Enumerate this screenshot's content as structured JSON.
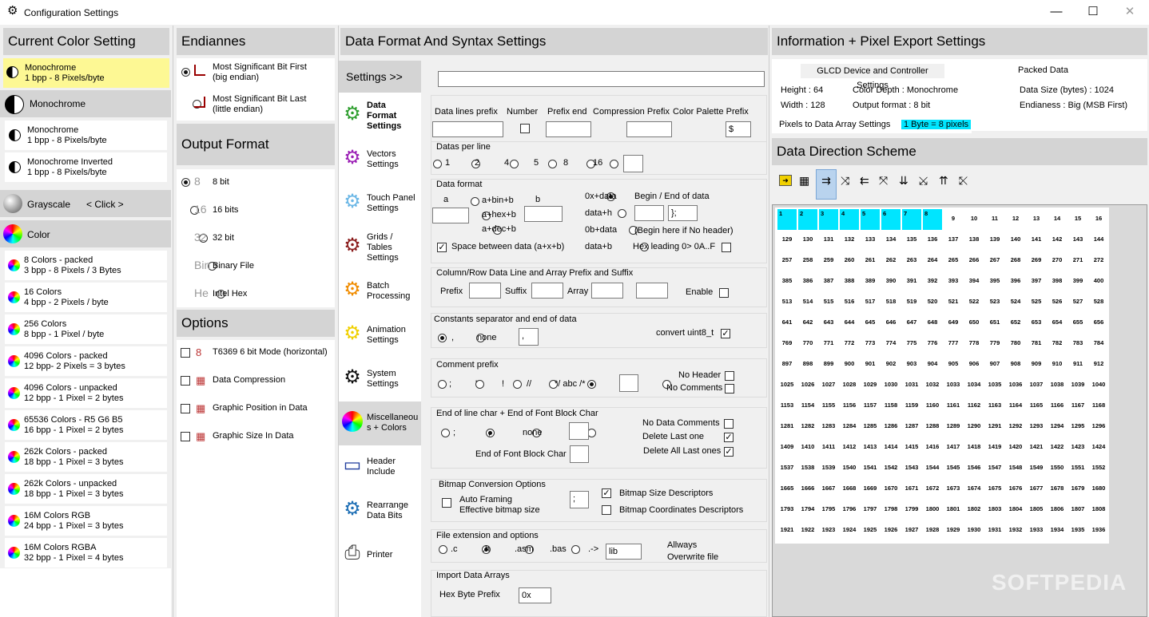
{
  "window": {
    "title": "Configuration Settings"
  },
  "colors": {
    "highlight_yellow": "#fdf894",
    "accent_cyan": "#00e5ff",
    "selected_tab": "#d9d9d9"
  },
  "current_color": {
    "header": "Current Color Setting",
    "selected_name": "Monochrome",
    "selected_desc": "1 bpp  - 8 Pixels/byte",
    "mono_group": "Monochrome",
    "mono_items": [
      {
        "name": "Monochrome",
        "desc": "1 bpp  - 8 Pixels/byte"
      },
      {
        "name": "Monochrome Inverted",
        "desc": "1 bpp  - 8 Pixels/byte"
      }
    ],
    "grayscale_label": "Grayscale",
    "grayscale_click": "< Click >",
    "color_group": "Color",
    "color_items": [
      {
        "name": "8 Colors - packed",
        "desc": "3 bpp - 8 Pixels / 3 Bytes"
      },
      {
        "name": "16 Colors",
        "desc": "4 bpp - 2 Pixels / byte"
      },
      {
        "name": "256 Colors",
        "desc": "8 bpp - 1 Pixel / byte"
      },
      {
        "name": "4096 Colors - packed",
        "desc": "12 bpp- 2 Pixels = 3 bytes"
      },
      {
        "name": "4096 Colors - unpacked",
        "desc": "12 bpp - 1 Pixel = 2 bytes"
      },
      {
        "name": "65536 Colors  - R5 G6 B5",
        "desc": "16 bpp - 1 Pixel = 2 bytes"
      },
      {
        "name": "262k Colors - packed",
        "desc": "18 bpp - 1 Pixel = 3 bytes"
      },
      {
        "name": "262k Colors - unpacked",
        "desc": "18 bpp - 1 Pixel = 3 bytes"
      },
      {
        "name": "16M Colors RGB",
        "desc": "24 bpp - 1 Pixel = 3 bytes"
      },
      {
        "name": "16M Colors RGBA",
        "desc": "32 bpp - 1 Pixel = 4 bytes"
      }
    ]
  },
  "endianness": {
    "header": "Endiannes",
    "msb_line1": "Most Significant Bit First",
    "msb_line2": "(big endian)",
    "lsb_line1": "Most Significant Bit Last",
    "lsb_line2": "(little endian)"
  },
  "output_format": {
    "header": "Output Format",
    "items": [
      {
        "icon": "8",
        "label": "8 bit"
      },
      {
        "icon": "16",
        "label": "16 bits"
      },
      {
        "icon": "32",
        "label": "32 bit"
      },
      {
        "icon": "Bin",
        "label": "Binary File"
      },
      {
        "icon": "He",
        "label": "Intel Hex"
      }
    ]
  },
  "options": {
    "header": "Options",
    "items": [
      {
        "icon": "8",
        "label": "T6369 6 bit Mode (horizontal)"
      },
      {
        "label": "Data Compression"
      },
      {
        "label": "Graphic Position in Data"
      },
      {
        "label": "Graphic Size In Data"
      }
    ]
  },
  "data_format": {
    "header": "Data Format And Syntax Settings",
    "settings_btn": "Settings >>",
    "nav": [
      {
        "l1": "Data",
        "l2": "Format",
        "l3": "Settings"
      },
      {
        "l1": "Vectors",
        "l2": "Settings"
      },
      {
        "l1": "Touch Panel",
        "l2": "Settings"
      },
      {
        "l1": "Grids /",
        "l2": "Tables",
        "l3": "Settings"
      },
      {
        "l1": "Batch",
        "l2": "Processing"
      },
      {
        "l1": "Animation",
        "l2": "Settings"
      },
      {
        "l1": "System",
        "l2": "Settings"
      },
      {
        "l1": "Miscellaneou",
        "l2": "s + Colors"
      },
      {
        "l1": "Header",
        "l2": "Include"
      },
      {
        "l1": "Rearrange",
        "l2": "Data Bits"
      },
      {
        "l1": "Printer"
      }
    ],
    "labels": {
      "data_lines_prefix": "Data lines prefix",
      "number": "Number",
      "prefix_end": "Prefix end",
      "compression_prefix": "Compression Prefix",
      "color_palette_prefix": "Color Palette Prefix",
      "color_palette_value": "$",
      "datas_per_line": "Datas per line",
      "dpl_options": [
        "1",
        "2",
        "4",
        "5",
        "8",
        "16"
      ],
      "data_format": "Data format",
      "a": "a",
      "b": "b",
      "a_bin": "a+bin+b",
      "a_hex": "a+hex+b",
      "a_dec": "a+dec+b",
      "hex_0x": "0x+data",
      "data_h": "data+h",
      "bin_0b": "0b+data",
      "data_b": "data+b",
      "begin_end": "Begin / End of data",
      "end_value": "};",
      "begin_note": "(Begin here if No header)",
      "hex_leading": "Hex leading 0> 0A..F",
      "space_between": "Space between data (a+x+b)",
      "colrow_title": "Column/Row Data Line and Array Prefix and Suffix",
      "prefix": "Prefix",
      "suffix": "Suffix",
      "array": "Array",
      "enable": "Enable",
      "constants_title": "Constants separator and end of data",
      "comma": ",",
      "none": "none",
      "const_value": ",",
      "convert_uint8": "convert uint8_t",
      "comment_title": "Comment prefix",
      "c_semicolon": ";",
      "c_quote": "'",
      "c_bang": "!",
      "c_slash": "//",
      "c_block": "*/ abc /*",
      "no_header": "No Header",
      "no_comments": "No Comments",
      "eol_title": "End of line char  + End of Font Block Char",
      "eol_semicolon": ";",
      "eol_comma": ",",
      "eol_none": "none",
      "no_data_comments": "No Data Comments",
      "delete_last_one": "Delete Last one",
      "delete_all_last": "Delete All Last ones",
      "end_font_block": "End of Font Block Char",
      "bitmap_title": "Bitmap Conversion Options",
      "auto_framing": "Auto Framing",
      "effective_bitmap": "Effective bitmap size",
      "bitmap_value": ";",
      "bitmap_size_desc": "Bitmap Size Descriptors",
      "bitmap_coord_desc": "Bitmap Coordinates Descriptors",
      "file_ext_title": "File extension and options",
      "ext_c": ".c",
      "ext_h": ".h",
      "ext_asm": ".asm",
      "ext_bas": ".bas",
      "ext_custom": ".->",
      "ext_value": "lib",
      "always": "Allways",
      "overwrite": "Overwrite file",
      "import_title": "Import Data Arrays",
      "hex_byte_prefix": "Hex Byte Prefix",
      "hex_byte_value": "0x"
    }
  },
  "info": {
    "header": "Information + Pixel Export Settings",
    "glcd_tab": "GLCD Device and Controller Settings",
    "packed_data": "Packed Data",
    "height": "Height : 64",
    "width": "Width :  128",
    "color_depth": "Color Depth :  Monochrome",
    "output_format": "Output format :  8 bit",
    "data_size": "Data Size (bytes) :  1024",
    "endianness": "Endianess :  Big (MSB First)",
    "pixels_to_data": "Pixels to Data Array Settings",
    "byte_pixels": "1 Byte = 8 pixels",
    "direction_header": "Data Direction Scheme",
    "grid_first": 1,
    "grid_stride": 128,
    "grid_cols": 16,
    "grid_rows": 16,
    "grid_highlight_count": 8
  },
  "watermark": "SOFTPEDIA"
}
